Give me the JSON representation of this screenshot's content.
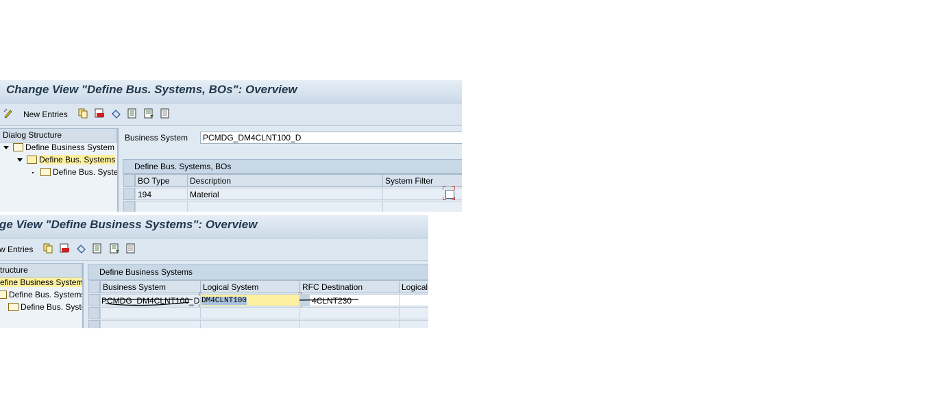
{
  "top": {
    "title": "Change View \"Define Bus. Systems,  BOs\": Overview",
    "toolbar": {
      "new_entries": "New Entries"
    },
    "tree": {
      "header": "Dialog Structure",
      "nodes": [
        "Define Business System",
        "Define Bus. Systems",
        "Define Bus. Syste"
      ]
    },
    "business_system_label": "Business System",
    "business_system_value": "PCMDG_DM4CLNT100_D",
    "group_title": "Define Bus. Systems,  BOs",
    "columns": [
      "BO Type",
      "Description",
      "System Filter"
    ],
    "rows": [
      {
        "bo_type": "194",
        "description": "Material",
        "system_filter": false
      }
    ]
  },
  "bottom": {
    "title": "ge View \"Define Business Systems\": Overview",
    "toolbar": {
      "new_entries": "w Entries"
    },
    "tree": {
      "header": "tructure",
      "nodes": [
        "efine Business System",
        "Define Bus. Systems",
        "Define Bus. Syste"
      ]
    },
    "group_title": "Define Business Systems",
    "columns": [
      "Business System",
      "Logical System",
      "RFC Destination",
      "Logical"
    ],
    "rows": [
      {
        "business_system": "PCMDG_DM4CLNT100_D",
        "logical_system": "DM4CLNT100",
        "rfc_destination": "4CLNT230"
      }
    ]
  },
  "colors": {
    "highlight": "#fdf1a0",
    "focus": "#cc2222",
    "selection": "#a9c1dd"
  }
}
